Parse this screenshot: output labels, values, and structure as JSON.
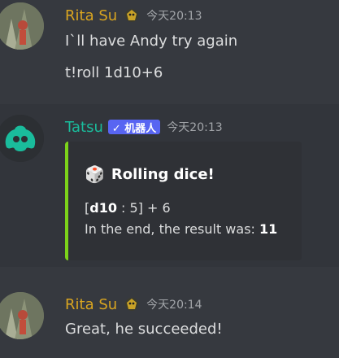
{
  "messages": [
    {
      "author": "Rita Su",
      "timestamp": "今天20:13",
      "lines": [
        "I`ll have Andy try again",
        "t!roll 1d10+6"
      ]
    },
    {
      "author": "Tatsu",
      "bot_tag": "✓ 机器人",
      "timestamp": "今天20:13",
      "embed": {
        "icon": "🎲",
        "title": "Rolling dice!",
        "roll_prefix": "[",
        "roll_die": "d10",
        "roll_rest": " : 5] + 6",
        "result_prefix": "In the end, the result was: ",
        "result_value": "11",
        "accent_color": "#7cd31a"
      }
    },
    {
      "author": "Rita Su",
      "timestamp": "今天20:14",
      "lines": [
        "Great, he succeeded!"
      ]
    }
  ],
  "colors": {
    "background": "#36393f",
    "rita_name": "#d9a520",
    "tatsu_name": "#1abc9c",
    "bot_tag": "#5865f2"
  }
}
